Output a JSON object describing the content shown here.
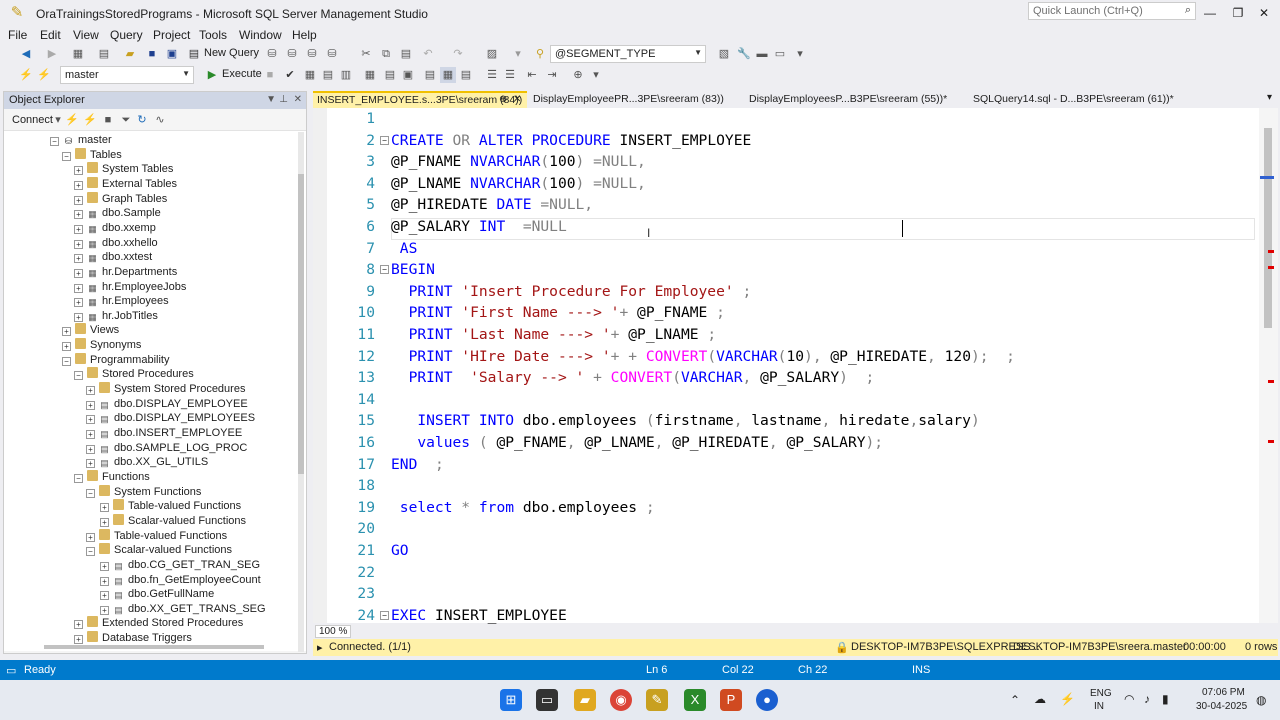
{
  "window": {
    "title": "OraTrainingsStoredPrograms - Microsoft SQL Server Management Studio",
    "quick_launch_placeholder": "Quick Launch (Ctrl+Q)"
  },
  "menu": [
    "File",
    "Edit",
    "View",
    "Query",
    "Project",
    "Tools",
    "Window",
    "Help"
  ],
  "toolbar": {
    "new_query": "New Query",
    "param_combo": "@SEGMENT_TYPE",
    "database_combo": "master",
    "execute": "Execute"
  },
  "object_explorer": {
    "title": "Object Explorer",
    "connect": "Connect",
    "tree": [
      {
        "label": "master",
        "level": 0,
        "exp": "−",
        "icon": "db"
      },
      {
        "label": "Tables",
        "level": 1,
        "exp": "−",
        "icon": "folder"
      },
      {
        "label": "System Tables",
        "level": 2,
        "exp": "+",
        "icon": "folder"
      },
      {
        "label": "External Tables",
        "level": 2,
        "exp": "+",
        "icon": "folder"
      },
      {
        "label": "Graph Tables",
        "level": 2,
        "exp": "+",
        "icon": "folder"
      },
      {
        "label": "dbo.Sample",
        "level": 2,
        "exp": "+",
        "icon": "table"
      },
      {
        "label": "dbo.xxemp",
        "level": 2,
        "exp": "+",
        "icon": "table"
      },
      {
        "label": "dbo.xxhello",
        "level": 2,
        "exp": "+",
        "icon": "table"
      },
      {
        "label": "dbo.xxtest",
        "level": 2,
        "exp": "+",
        "icon": "table"
      },
      {
        "label": "hr.Departments",
        "level": 2,
        "exp": "+",
        "icon": "table"
      },
      {
        "label": "hr.EmployeeJobs",
        "level": 2,
        "exp": "+",
        "icon": "table"
      },
      {
        "label": "hr.Employees",
        "level": 2,
        "exp": "+",
        "icon": "table"
      },
      {
        "label": "hr.JobTitles",
        "level": 2,
        "exp": "+",
        "icon": "table"
      },
      {
        "label": "Views",
        "level": 1,
        "exp": "+",
        "icon": "folder"
      },
      {
        "label": "Synonyms",
        "level": 1,
        "exp": "+",
        "icon": "folder"
      },
      {
        "label": "Programmability",
        "level": 1,
        "exp": "−",
        "icon": "folder"
      },
      {
        "label": "Stored Procedures",
        "level": 2,
        "exp": "−",
        "icon": "folder"
      },
      {
        "label": "System Stored Procedures",
        "level": 3,
        "exp": "+",
        "icon": "folder"
      },
      {
        "label": "dbo.DISPLAY_EMPLOYEE",
        "level": 3,
        "exp": "+",
        "icon": "proc"
      },
      {
        "label": "dbo.DISPLAY_EMPLOYEES",
        "level": 3,
        "exp": "+",
        "icon": "proc"
      },
      {
        "label": "dbo.INSERT_EMPLOYEE",
        "level": 3,
        "exp": "+",
        "icon": "proc"
      },
      {
        "label": "dbo.SAMPLE_LOG_PROC",
        "level": 3,
        "exp": "+",
        "icon": "proc"
      },
      {
        "label": "dbo.XX_GL_UTILS",
        "level": 3,
        "exp": "+",
        "icon": "proc"
      },
      {
        "label": "Functions",
        "level": 2,
        "exp": "−",
        "icon": "folder"
      },
      {
        "label": "System Functions",
        "level": 3,
        "exp": "−",
        "icon": "folder"
      },
      {
        "label": "Table-valued Functions",
        "level": 4,
        "exp": "+",
        "icon": "folder"
      },
      {
        "label": "Scalar-valued Functions",
        "level": 4,
        "exp": "+",
        "icon": "folder"
      },
      {
        "label": "Table-valued Functions",
        "level": 3,
        "exp": "+",
        "icon": "folder"
      },
      {
        "label": "Scalar-valued Functions",
        "level": 3,
        "exp": "−",
        "icon": "folder"
      },
      {
        "label": "dbo.CG_GET_TRAN_SEG",
        "level": 4,
        "exp": "+",
        "icon": "proc"
      },
      {
        "label": "dbo.fn_GetEmployeeCount",
        "level": 4,
        "exp": "+",
        "icon": "proc"
      },
      {
        "label": "dbo.GetFullName",
        "level": 4,
        "exp": "+",
        "icon": "proc"
      },
      {
        "label": "dbo.XX_GET_TRANS_SEG",
        "level": 4,
        "exp": "+",
        "icon": "proc"
      },
      {
        "label": "Extended Stored Procedures",
        "level": 2,
        "exp": "+",
        "icon": "folder"
      },
      {
        "label": "Database Triggers",
        "level": 2,
        "exp": "+",
        "icon": "folder"
      }
    ]
  },
  "tabs": [
    {
      "label": "INSERT_EMPLOYEE.s...3PE\\sreeram (84))",
      "pin": "⊕",
      "close": "✕"
    },
    {
      "label": "DisplayEmployeePR...3PE\\sreeram (83))"
    },
    {
      "label": "DisplayEmployeesP...B3PE\\sreeram (55))*"
    },
    {
      "label": "SQLQuery14.sql - D...B3PE\\sreeram (61))*"
    }
  ],
  "code": [
    {
      "n": "1",
      "fold": "",
      "tokens": []
    },
    {
      "n": "2",
      "fold": "−",
      "tokens": [
        [
          "kw",
          "CREATE "
        ],
        [
          "gr",
          "OR "
        ],
        [
          "kw",
          "ALTER PROCEDURE "
        ],
        [
          "",
          "INSERT_EMPLOYEE"
        ]
      ]
    },
    {
      "n": "3",
      "fold": "",
      "tokens": [
        [
          "",
          "@P_FNAME "
        ],
        [
          "kw",
          "NVARCHAR"
        ],
        [
          "gr",
          "("
        ],
        [
          "",
          "100"
        ],
        [
          "gr",
          ") =NULL,"
        ]
      ]
    },
    {
      "n": "4",
      "fold": "",
      "tokens": [
        [
          "",
          "@P_LNAME "
        ],
        [
          "kw",
          "NVARCHAR"
        ],
        [
          "gr",
          "("
        ],
        [
          "",
          "100"
        ],
        [
          "gr",
          ") =NULL,"
        ]
      ]
    },
    {
      "n": "5",
      "fold": "",
      "tokens": [
        [
          "",
          "@P_HIREDATE "
        ],
        [
          "kw",
          "DATE "
        ],
        [
          "gr",
          "=NULL,"
        ]
      ]
    },
    {
      "n": "6",
      "fold": "",
      "tokens": [
        [
          "",
          "@P_SALARY "
        ],
        [
          "kw",
          "INT  "
        ],
        [
          "gr",
          "=NULL"
        ]
      ]
    },
    {
      "n": "7",
      "fold": "",
      "tokens": [
        [
          "kw",
          " AS"
        ]
      ]
    },
    {
      "n": "8",
      "fold": "−",
      "tokens": [
        [
          "kw",
          "BEGIN"
        ]
      ]
    },
    {
      "n": "9",
      "fold": "",
      "tokens": [
        [
          "kw",
          "  PRINT "
        ],
        [
          "str",
          "'Insert Procedure For Employee' "
        ],
        [
          "gr",
          ";"
        ]
      ]
    },
    {
      "n": "10",
      "fold": "",
      "tokens": [
        [
          "kw",
          "  PRINT "
        ],
        [
          "str",
          "'First Name ---> '"
        ],
        [
          "gr",
          "+ "
        ],
        [
          "",
          "@P_FNAME "
        ],
        [
          "gr",
          ";"
        ]
      ]
    },
    {
      "n": "11",
      "fold": "",
      "tokens": [
        [
          "kw",
          "  PRINT "
        ],
        [
          "str",
          "'Last Name ---> '"
        ],
        [
          "gr",
          "+ "
        ],
        [
          "",
          "@P_LNAME "
        ],
        [
          "gr",
          ";"
        ]
      ]
    },
    {
      "n": "12",
      "fold": "",
      "tokens": [
        [
          "kw",
          "  PRINT "
        ],
        [
          "str",
          "'HIre Date ---> '"
        ],
        [
          "gr",
          "+ + "
        ],
        [
          "fn",
          "CONVERT"
        ],
        [
          "gr",
          "("
        ],
        [
          "kw",
          "VARCHAR"
        ],
        [
          "gr",
          "("
        ],
        [
          "",
          "10"
        ],
        [
          "gr",
          "), "
        ],
        [
          "",
          "@P_HIREDATE"
        ],
        [
          "gr",
          ", "
        ],
        [
          "",
          "120"
        ],
        [
          "gr",
          ");  ;"
        ]
      ]
    },
    {
      "n": "13",
      "fold": "",
      "tokens": [
        [
          "kw",
          "  PRINT  "
        ],
        [
          "str",
          "'Salary --> ' "
        ],
        [
          "gr",
          "+ "
        ],
        [
          "fn",
          "CONVERT"
        ],
        [
          "gr",
          "("
        ],
        [
          "kw",
          "VARCHAR"
        ],
        [
          "gr",
          ", "
        ],
        [
          "",
          "@P_SALARY"
        ],
        [
          "gr",
          ")  ;"
        ]
      ]
    },
    {
      "n": "14",
      "fold": "",
      "tokens": []
    },
    {
      "n": "15",
      "fold": "",
      "tokens": [
        [
          "kw",
          "   INSERT INTO "
        ],
        [
          "",
          "dbo.employees "
        ],
        [
          "gr",
          "("
        ],
        [
          "",
          "firstname"
        ],
        [
          "gr",
          ", "
        ],
        [
          "",
          "lastname"
        ],
        [
          "gr",
          ", "
        ],
        [
          "",
          "hiredate"
        ],
        [
          "gr",
          ","
        ],
        [
          "",
          "salary"
        ],
        [
          "gr",
          ")"
        ]
      ]
    },
    {
      "n": "16",
      "fold": "",
      "tokens": [
        [
          "kw",
          "   values "
        ],
        [
          "gr",
          "( "
        ],
        [
          "",
          "@P_FNAME"
        ],
        [
          "gr",
          ", "
        ],
        [
          "",
          "@P_LNAME"
        ],
        [
          "gr",
          ", "
        ],
        [
          "",
          "@P_HIREDATE"
        ],
        [
          "gr",
          ", "
        ],
        [
          "",
          "@P_SALARY"
        ],
        [
          "gr",
          ");"
        ]
      ]
    },
    {
      "n": "17",
      "fold": "",
      "tokens": [
        [
          "kw",
          "END  "
        ],
        [
          "gr",
          ";"
        ]
      ]
    },
    {
      "n": "18",
      "fold": "",
      "tokens": []
    },
    {
      "n": "19",
      "fold": "",
      "tokens": [
        [
          "kw",
          " select "
        ],
        [
          "gr",
          "* "
        ],
        [
          "kw",
          "from "
        ],
        [
          "",
          "dbo.employees "
        ],
        [
          "gr",
          ";"
        ]
      ]
    },
    {
      "n": "20",
      "fold": "",
      "tokens": []
    },
    {
      "n": "21",
      "fold": "",
      "tokens": [
        [
          "kw",
          "GO"
        ]
      ]
    },
    {
      "n": "22",
      "fold": "",
      "tokens": []
    },
    {
      "n": "23",
      "fold": "",
      "tokens": []
    },
    {
      "n": "24",
      "fold": "−",
      "tokens": [
        [
          "kw",
          "EXEC "
        ],
        [
          "",
          "INSERT_EMPLOYEE"
        ]
      ]
    }
  ],
  "zoom": "100 %",
  "query_status": {
    "connected": "Connected. (1/1)",
    "server": "DESKTOP-IM7B3PE\\SQLEXPRESS ...",
    "user": "DESKTOP-IM7B3PE\\sreera...",
    "database": "master",
    "elapsed": "00:00:00",
    "rows": "0 rows"
  },
  "status": {
    "ready": "Ready",
    "ln": "Ln 6",
    "col": "Col 22",
    "ch": "Ch 22",
    "ins": "INS"
  },
  "tray": {
    "lang1": "ENG",
    "lang2": "IN",
    "time": "07:06 PM",
    "date": "30-04-2025"
  }
}
